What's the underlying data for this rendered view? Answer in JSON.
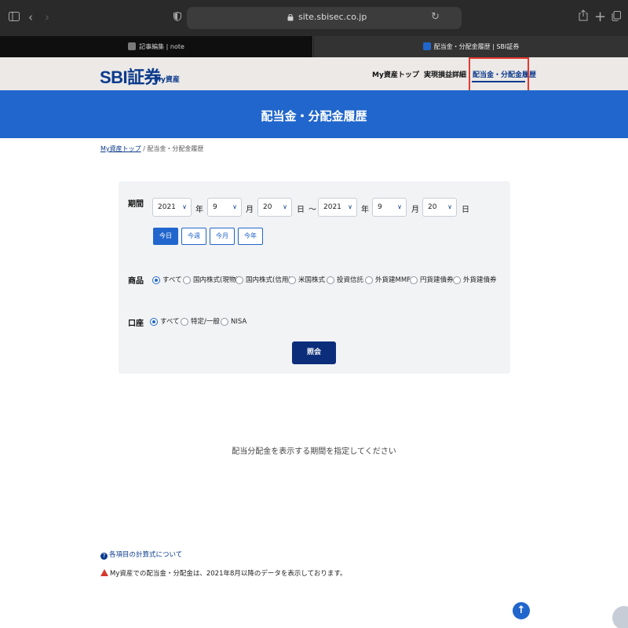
{
  "browser": {
    "url": "site.sbisec.co.jp",
    "tabs": [
      {
        "label": "記事編集 | note",
        "active": false
      },
      {
        "label": "配当金・分配金履歴 | SBI証券",
        "active": true
      }
    ]
  },
  "site": {
    "logo": "SBI証券",
    "logo_sub": "My資産",
    "nav": [
      {
        "label": "My資産トップ",
        "active": false
      },
      {
        "label": "実現損益詳細",
        "active": false
      },
      {
        "label": "配当金・分配金履歴",
        "active": true
      }
    ]
  },
  "page": {
    "title": "配当金・分配金履歴",
    "breadcrumb": {
      "link": "My資産トップ",
      "separator": "/",
      "current": "配当金・分配金履歴"
    }
  },
  "filter": {
    "period": {
      "label": "期間",
      "from": {
        "year": "2021",
        "month": "9",
        "day": "20"
      },
      "to": {
        "year": "2021",
        "month": "9",
        "day": "20"
      },
      "unit_year": "年",
      "unit_month": "月",
      "unit_day": "日",
      "range_sep": "〜",
      "quick": [
        {
          "label": "今日",
          "active": true
        },
        {
          "label": "今週",
          "active": false
        },
        {
          "label": "今月",
          "active": false
        },
        {
          "label": "今年",
          "active": false
        }
      ]
    },
    "product": {
      "label": "商品",
      "options": [
        {
          "label": "すべて",
          "checked": true
        },
        {
          "label": "国内株式(現物)",
          "checked": false
        },
        {
          "label": "国内株式(信用)",
          "checked": false
        },
        {
          "label": "米国株式",
          "checked": false
        },
        {
          "label": "投資信託",
          "checked": false
        },
        {
          "label": "外貨建MMF",
          "checked": false
        },
        {
          "label": "円貨建債券",
          "checked": false
        },
        {
          "label": "外貨建債券",
          "checked": false
        }
      ]
    },
    "account": {
      "label": "口座",
      "options": [
        {
          "label": "すべて",
          "checked": true
        },
        {
          "label": "特定/一般",
          "checked": false
        },
        {
          "label": "NISA",
          "checked": false
        }
      ]
    },
    "submit": "照会"
  },
  "empty_message": "配当分配金を表示する期間を指定してください",
  "footer": {
    "help_icon": "?",
    "help_link": "各項目の計算式について",
    "notice": "My資産での配当金・分配金は、2021年8月以降のデータを表示しております。"
  },
  "scroll_top_icon": "↑",
  "colors": {
    "brand": "#0b3a8c",
    "banner": "#2166cc",
    "highlight": "#e53a2e"
  }
}
